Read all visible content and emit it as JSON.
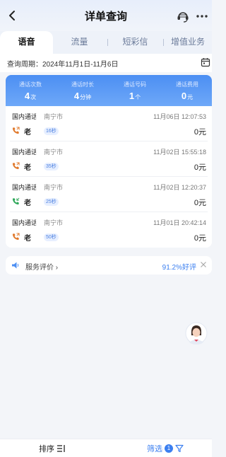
{
  "header": {
    "title": "详单查询",
    "back_icon": "chevron-left-icon",
    "service_icon": "customer-service-icon",
    "more_icon": "more-dots-icon"
  },
  "tabs": [
    {
      "label": "语音",
      "active": true
    },
    {
      "label": "流量",
      "active": false
    },
    {
      "label": "短彩信",
      "active": false
    },
    {
      "label": "增值业务",
      "active": false
    }
  ],
  "period": {
    "text": "查询周期：2024年11月1日-11月6日",
    "calendar_icon": "calendar-icon"
  },
  "summary": {
    "colors": {
      "card_top": "#4c8ff3",
      "card_bottom": "#6ea8f8"
    },
    "stats": [
      {
        "label": "通话次数",
        "value": "4",
        "unit": "次"
      },
      {
        "label": "通话时长",
        "value": "4",
        "unit": "分钟"
      },
      {
        "label": "通话号码",
        "value": "1",
        "unit": "个"
      },
      {
        "label": "通话费用",
        "value": "0",
        "unit": "元"
      }
    ]
  },
  "records": [
    {
      "type": "国内通话",
      "city": "南宁市",
      "time": "11月06日 12:07:53",
      "name": "老",
      "duration": "16秒",
      "fee": "0元",
      "direction": "outgoing",
      "icon": "phone-outgoing-icon",
      "icon_color": "#e0792c"
    },
    {
      "type": "国内通话",
      "city": "南宁市",
      "time": "11月02日 15:55:18",
      "name": "老",
      "duration": "35秒",
      "fee": "0元",
      "direction": "outgoing",
      "icon": "phone-outgoing-icon",
      "icon_color": "#e0792c"
    },
    {
      "type": "国内通话",
      "city": "南宁市",
      "time": "11月02日 12:20:37",
      "name": "老",
      "duration": "25秒",
      "fee": "0元",
      "direction": "incoming",
      "icon": "phone-incoming-icon",
      "icon_color": "#2fa85a"
    },
    {
      "type": "国内通话",
      "city": "南宁市",
      "time": "11月01日 20:42:14",
      "name": "老",
      "duration": "50秒",
      "fee": "0元",
      "direction": "outgoing",
      "icon": "phone-outgoing-icon",
      "icon_color": "#e0792c"
    }
  ],
  "feedback": {
    "label": "服务评价 ›",
    "score": "91.2%好评",
    "icon": "speaker-icon",
    "close_icon": "close-icon"
  },
  "assistant": {
    "icon": "assistant-avatar-icon"
  },
  "bottom": {
    "sort_label": "排序",
    "sort_icon": "sort-icon",
    "filter_label": "筛选",
    "filter_count": "1",
    "filter_icon": "filter-funnel-icon",
    "accent": "#3b7ff0"
  }
}
